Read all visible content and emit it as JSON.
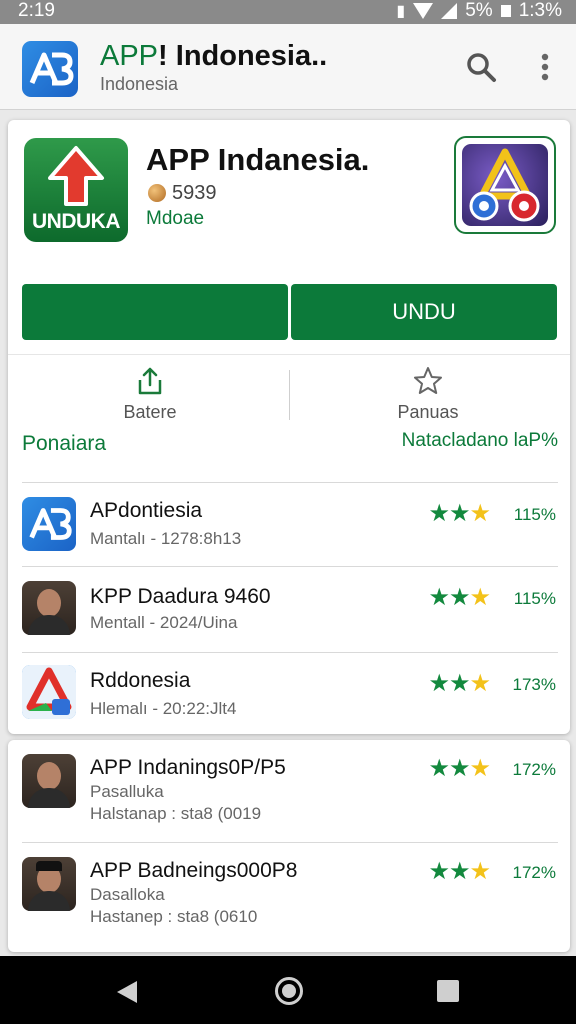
{
  "status_bar": {
    "time": "2:19",
    "battery": "5%",
    "clock_right": "1:3%"
  },
  "app_bar": {
    "title_prefix": "APP",
    "title_sep": "!",
    "title_main": "Indonesia..",
    "subtitle": "Indonesia",
    "icons": [
      "app-logo-icon",
      "search-icon",
      "more-vert-icon"
    ]
  },
  "header": {
    "app_icon_label": "UNDUKA",
    "app_name": "APP Indanesia.",
    "coin_value": "5939",
    "developer": "Mdoae"
  },
  "buttons": {
    "left_label": "",
    "right_label": "UNDU"
  },
  "actions": [
    {
      "icon": "share-icon",
      "label": "Batere"
    },
    {
      "icon": "star-outline-icon",
      "label": "Panuas"
    }
  ],
  "section": {
    "left": "Ponaiara",
    "right": "Natacladano laP%"
  },
  "list": [
    {
      "icon": "app-logo-icon",
      "title": "APdontiesia",
      "line2": "Mantalı - 1278:8h13",
      "line3": "",
      "stars_green": 2,
      "stars_yellow": 1,
      "rating": "115%"
    },
    {
      "icon": "avatar-man-icon",
      "title": "KPP Daadura 9460",
      "line2": "Mentall - 2024/Uina",
      "line3": "",
      "stars_green": 2,
      "stars_yellow": 1,
      "rating": "115%"
    },
    {
      "icon": "red-a-app-icon",
      "title": "Rddonesia",
      "line2": "Hlemalı - 20:22:Jlt4",
      "line3": "",
      "stars_green": 2,
      "stars_yellow": 1,
      "rating": "173%"
    },
    {
      "icon": "avatar-man-icon",
      "title": "APP Indanings0P/P5",
      "line2": "Pasalluka",
      "line3": "Halstanap : sta8 (0019",
      "stars_green": 2,
      "stars_yellow": 1,
      "rating": "172%"
    },
    {
      "icon": "avatar-cap-icon",
      "title": "APP Badneings000P8",
      "line2": "Dasalloka",
      "line3": "Hastanep : sta8 (0610",
      "stars_green": 2,
      "stars_yellow": 1,
      "rating": "172%"
    }
  ],
  "colors": {
    "accent_green": "#0c7a3a",
    "star_yellow": "#f3c21a",
    "logo_blue": "#1b63c6"
  },
  "nav": [
    "back-icon",
    "home-icon",
    "recents-icon"
  ]
}
